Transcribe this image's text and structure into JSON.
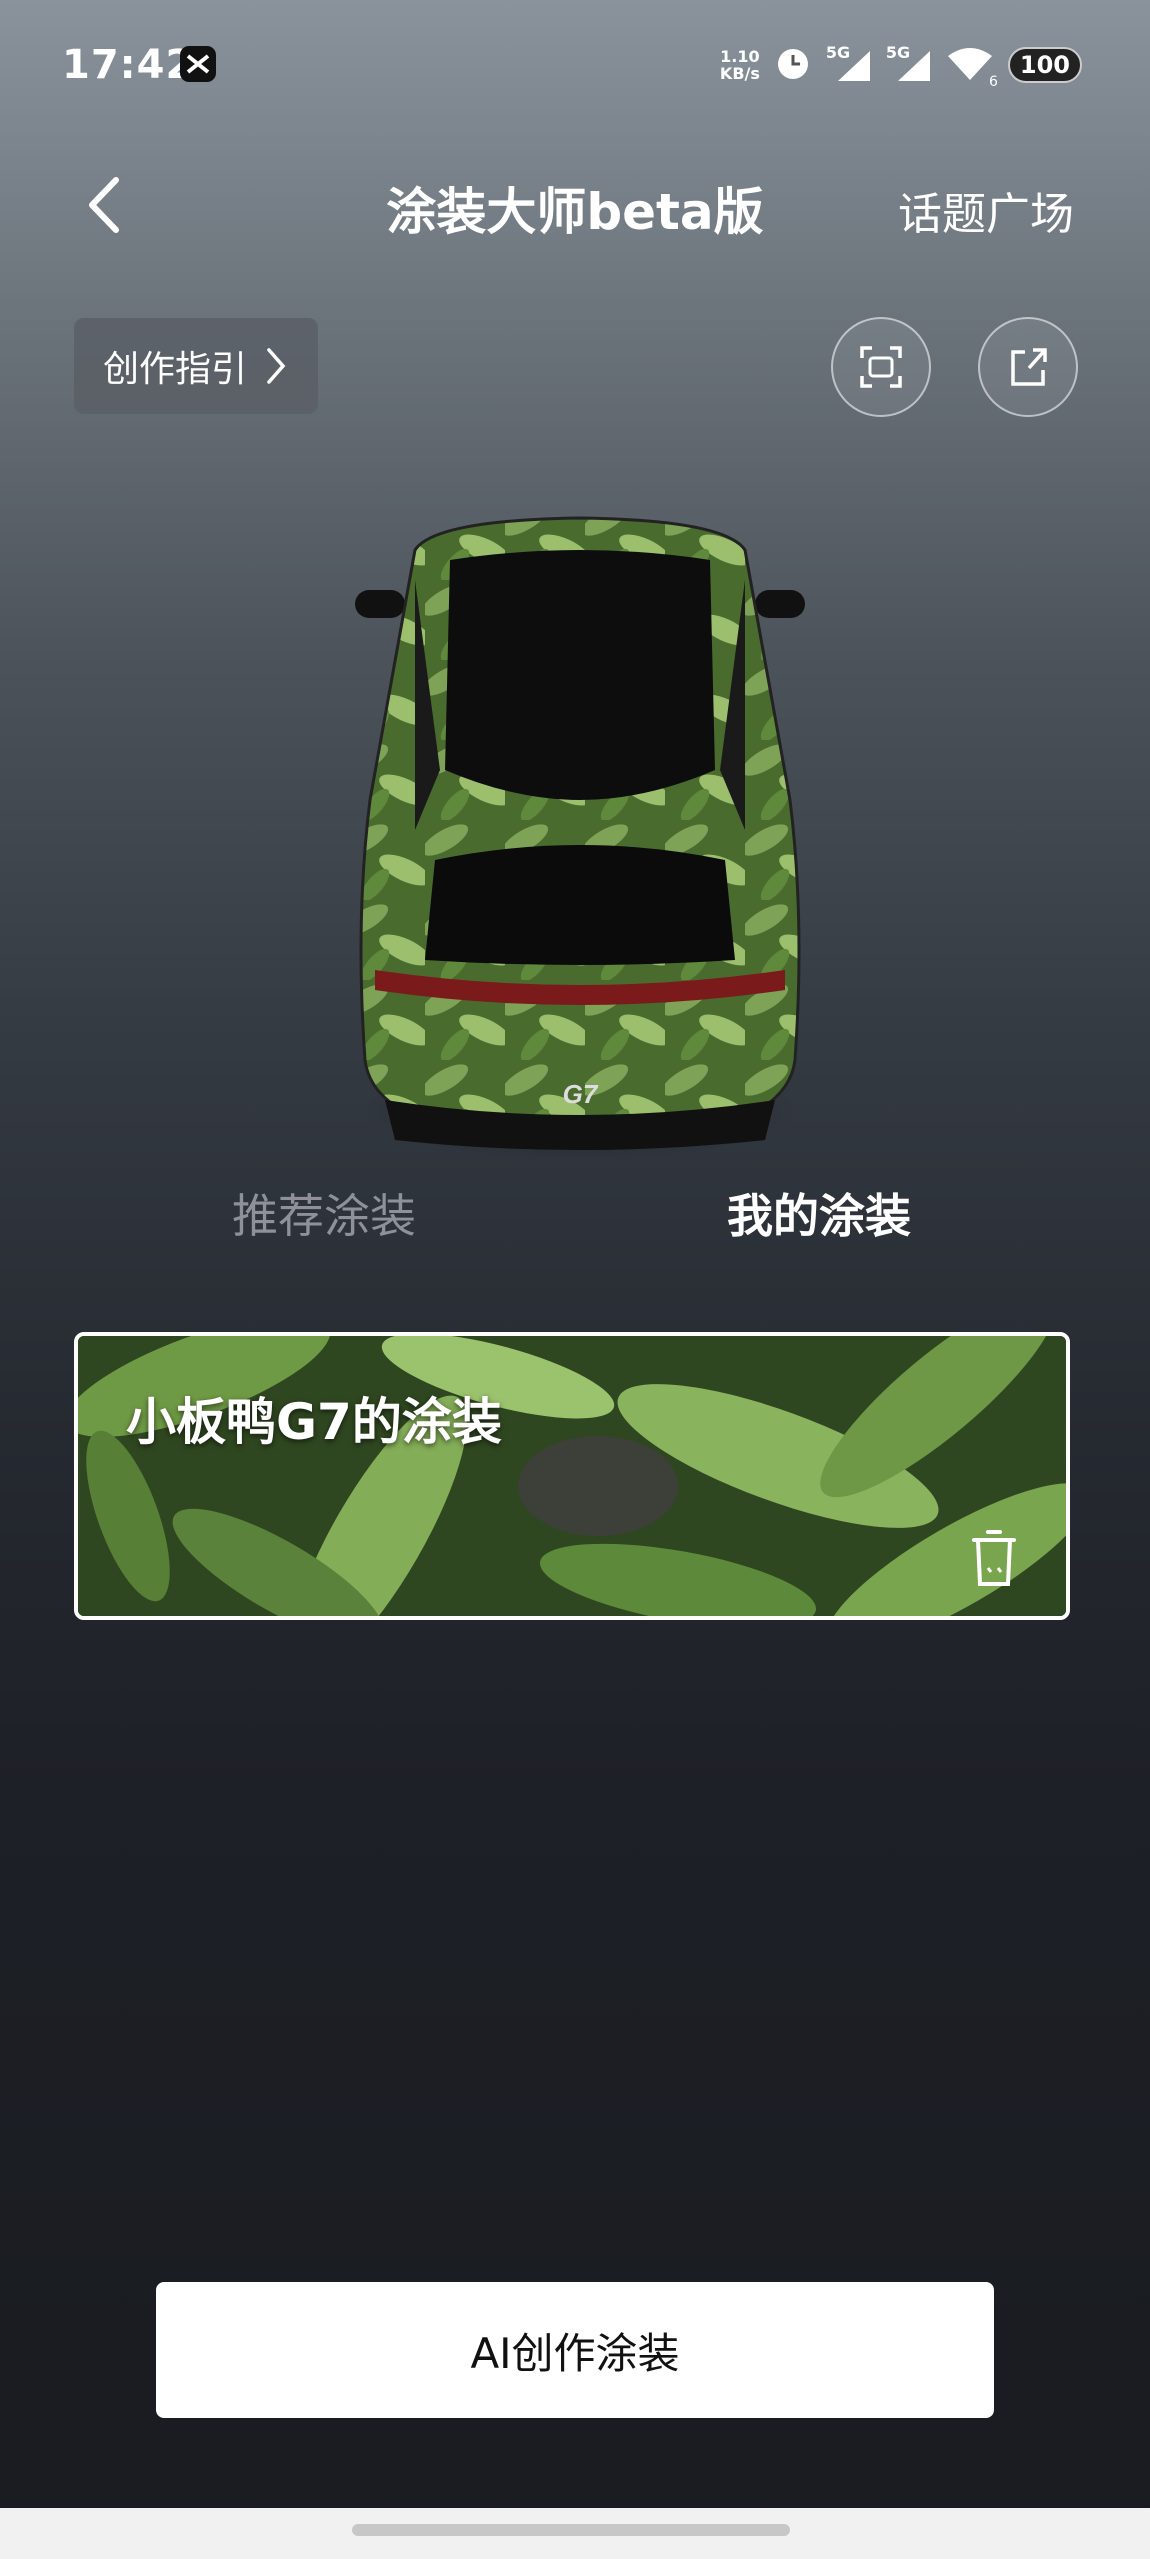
{
  "status_bar": {
    "time": "17:42",
    "net_speed_value": "1.10",
    "net_speed_unit": "KB/s",
    "signal1_label": "5G",
    "signal2_label": "5G",
    "wifi_label": "6",
    "battery": "100"
  },
  "header": {
    "title": "涂装大师beta版",
    "topic_link": "话题广场"
  },
  "toolbar": {
    "guide_label": "创作指引"
  },
  "tabs": [
    {
      "label": "推荐涂装",
      "active": false
    },
    {
      "label": "我的涂装",
      "active": true
    }
  ],
  "card": {
    "title": "小板鸭G7的涂装"
  },
  "car": {
    "badge": "G7"
  },
  "bottom": {
    "ai_button": "AI创作涂装"
  },
  "colors": {
    "accent_white": "#ffffff",
    "inactive_tab": "#8e9298",
    "leaf_green": "#5f8a3c"
  }
}
